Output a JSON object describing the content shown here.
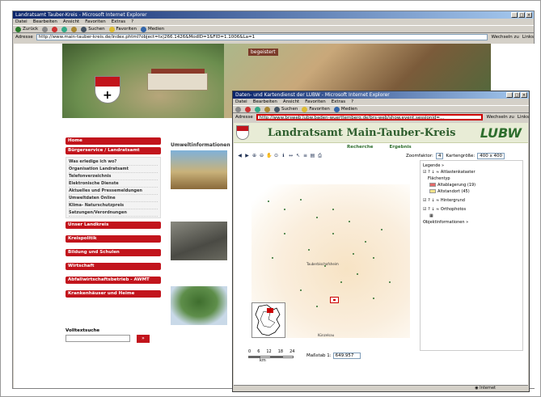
{
  "outer": {
    "title": "Landratsamt Tauber-Kreis - Microsoft Internet Explorer",
    "menu": [
      "Datei",
      "Bearbeiten",
      "Ansicht",
      "Favoriten",
      "Extras",
      "?"
    ],
    "toolbar": {
      "back": "Zurück",
      "search": "Suchen",
      "favorites": "Favoriten",
      "media": "Medien"
    },
    "address_label": "Adresse",
    "address": "http://www.main-tauber-kreis.de/index.phtml?object=tx|266.1426&ModID=1&FID=1.1006&La=1",
    "go": "Wechseln zu",
    "links": "Links"
  },
  "site": {
    "banner_text": "begeistert",
    "nav_home": "Home",
    "nav_buergerservice": "Bürgerservice / Landratsamt",
    "nav_sub": [
      "Was erledige ich wo?",
      "Organisation Landratsamt",
      "Telefonverzeichnis",
      "Elektronische Dienste",
      "Aktuelles und Pressemeldungen",
      "Umweltdaten Online",
      "Klima- Naturschutzpreis",
      "Satzungen/Verordnungen"
    ],
    "nav_main": [
      "Unser Landkreis",
      "Kreispolitik",
      "Bildung und Schulen",
      "Wirtschaft",
      "Abfallwirtschaftsbetrieb - AWMT",
      "Krankenhäuser und Heime"
    ],
    "search_label": "Volltextsuche",
    "search_button": "»",
    "section_title": "Umweltinformationen"
  },
  "popup": {
    "title": "Daten- und Kartendienst der LUBW - Microsoft Internet Explorer",
    "menu": [
      "Datei",
      "Bearbeiten",
      "Ansicht",
      "Favoriten",
      "Extras",
      "?"
    ],
    "address_label": "Adresse",
    "address": "http://www.brsweb.lubw.baden-wuerttemberg.de/brs-web/show.event.sessionid=...",
    "go": "Wechseln zu",
    "links": "Links",
    "page_title": "Landratsamt Main-Tauber-Kreis",
    "logo": "LUBW",
    "tabs": [
      "Recherche",
      "Ergebnis"
    ],
    "zoom_label": "Zoomfaktor:",
    "zoom_value": "4",
    "size_label": "Kartengröße:",
    "size_value": "400 x 400",
    "places": [
      "Tauberbischofsheim",
      "Künzelsau"
    ],
    "scale_ticks": [
      "0",
      "6",
      "12",
      "18",
      "24"
    ],
    "scale_unit": "km",
    "massstab_label": "Maßstab 1:",
    "massstab_value": "649.957",
    "legend": {
      "title": "Legende »",
      "layer1": "Altlastenkataster",
      "flaechentyp": "Flächentyp",
      "item1": "Altablagerung (19)",
      "item2": "Altstandort (45)",
      "layer2": "Hintergrund",
      "layer3": "Orthophotos",
      "objinfo": "Objektinformationen »"
    },
    "status": "Internet",
    "colors": {
      "altablagerung": "#e46a6a",
      "altstandort": "#f2e38a"
    }
  }
}
